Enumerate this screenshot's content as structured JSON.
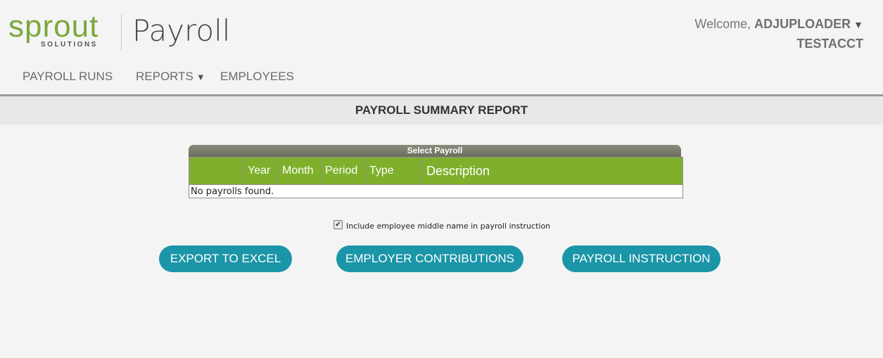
{
  "brand": {
    "logo_word": "sprout",
    "logo_sub": "SOLUTIONS",
    "app_title": "Payroll",
    "color": "#7aa83c"
  },
  "user": {
    "welcome": "Welcome, ",
    "name": "ADJUPLOADER",
    "caret": "▼",
    "account": "TESTACCT"
  },
  "nav": {
    "payroll_runs": "PAYROLL RUNS",
    "reports": "REPORTS",
    "reports_caret": "▼",
    "employees": "EMPLOYEES"
  },
  "page": {
    "title": "PAYROLL SUMMARY REPORT"
  },
  "select_payroll": {
    "heading": "Select Payroll",
    "columns": [
      "",
      "Year",
      "Month",
      "Period",
      "Type",
      "Description"
    ],
    "empty_message": "No payrolls found.",
    "header_color": "#7fb02c"
  },
  "options": {
    "middle_name_label": "Include employee middle name in payroll instruction",
    "middle_name_checked": true,
    "check_glyph": "✔"
  },
  "actions": {
    "export_excel": "EXPORT TO EXCEL",
    "employer_contributions": "EMPLOYER CONTRIBUTIONS",
    "payroll_instruction": "PAYROLL INSTRUCTION",
    "button_color": "#1b95a8"
  }
}
